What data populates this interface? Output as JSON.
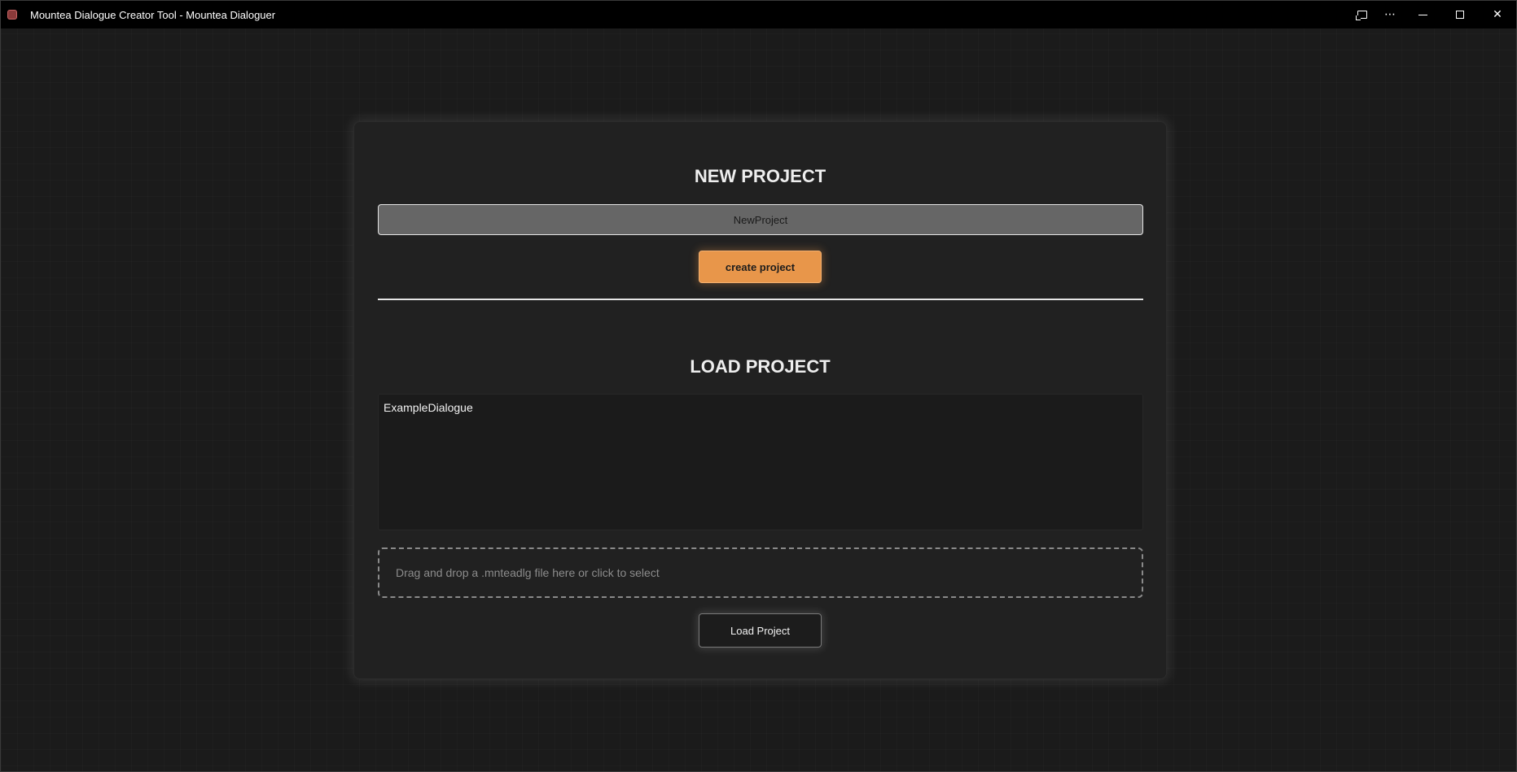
{
  "window": {
    "title": "Mountea Dialogue Creator Tool - Mountea Dialoguer",
    "controls": {
      "cast": "cast-icon",
      "more": "⋯",
      "minimize": "minimize-icon",
      "maximize": "maximize-icon",
      "close": "✕"
    }
  },
  "new_project": {
    "heading": "NEW PROJECT",
    "name_value": "NewProject",
    "create_label": "create project"
  },
  "load_project": {
    "heading": "LOAD PROJECT",
    "projects": [
      "ExampleDialogue"
    ],
    "dropzone_text": "Drag and drop a .mnteadlg file here or click to select",
    "load_label": "Load Project"
  },
  "colors": {
    "accent": "#e8964a",
    "panel": "#212121",
    "background": "#1b1b1b",
    "titlebar": "#000000"
  }
}
